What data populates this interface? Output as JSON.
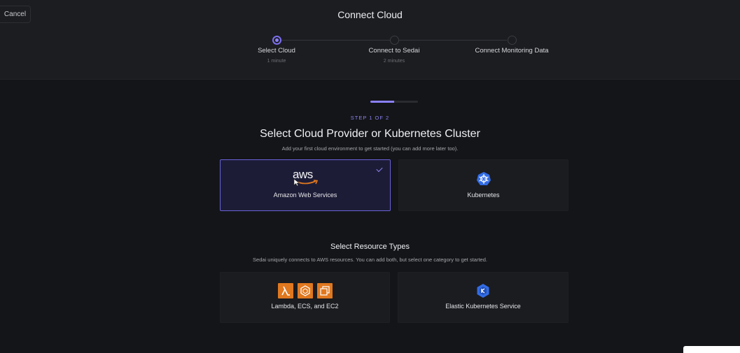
{
  "header": {
    "cancel_label": "Cancel",
    "title": "Connect Cloud"
  },
  "stepper": {
    "steps": [
      {
        "label": "Select Cloud",
        "sub": "1 minute",
        "active": true
      },
      {
        "label": "Connect to Sedai",
        "sub": "2 minutes",
        "active": false
      },
      {
        "label": "Connect Monitoring Data",
        "sub": "",
        "active": false
      }
    ]
  },
  "progress": {
    "fraction": 0.5
  },
  "step_counter": "STEP 1 OF 2",
  "provider": {
    "title": "Select Cloud Provider or Kubernetes Cluster",
    "subtitle": "Add your first cloud environment to get started (you can add more later too).",
    "options": [
      {
        "label": "Amazon Web Services",
        "logo_text": "aws",
        "selected": true
      },
      {
        "label": "Kubernetes",
        "selected": false
      }
    ]
  },
  "resources": {
    "title": "Select Resource Types",
    "subtitle": "Sedai uniquely connects to AWS resources. You can add both, but select one category to get started.",
    "options": [
      {
        "label": "Lambda, ECS, and EC2",
        "icons": [
          "lambda-icon",
          "ecs-icon",
          "ec2-icon"
        ]
      },
      {
        "label": "Elastic Kubernetes Service",
        "icons": [
          "eks-icon"
        ]
      }
    ]
  },
  "colors": {
    "accent": "#8b80ff",
    "aws_orange": "#e0781f",
    "kubernetes_blue": "#326ce5"
  }
}
